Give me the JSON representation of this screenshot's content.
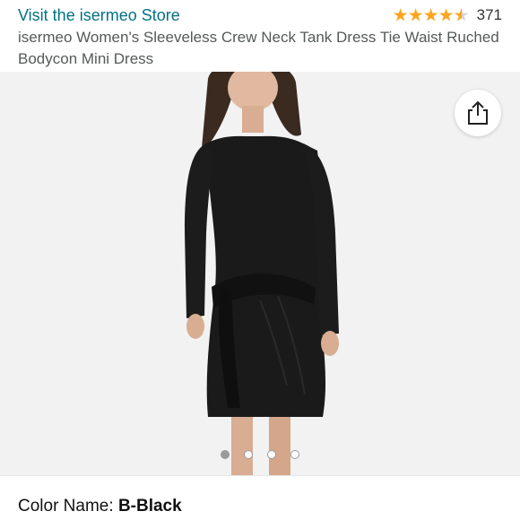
{
  "store": {
    "link_text": "Visit the isermeo Store"
  },
  "rating": {
    "stars": 4.5,
    "count": "371"
  },
  "product": {
    "title": "isermeo Women's Sleeveless Crew Neck Tank Dress Tie Waist Ruched Bodycon Mini Dress"
  },
  "gallery": {
    "total_images": 4,
    "active_index": 0
  },
  "color": {
    "label": "Color Name:",
    "value": "B-Black"
  },
  "colors": {
    "accent_link": "#007185",
    "star": "#FFA41C",
    "dress": "#1a1a1a"
  },
  "icons": {
    "share": "share-icon"
  }
}
